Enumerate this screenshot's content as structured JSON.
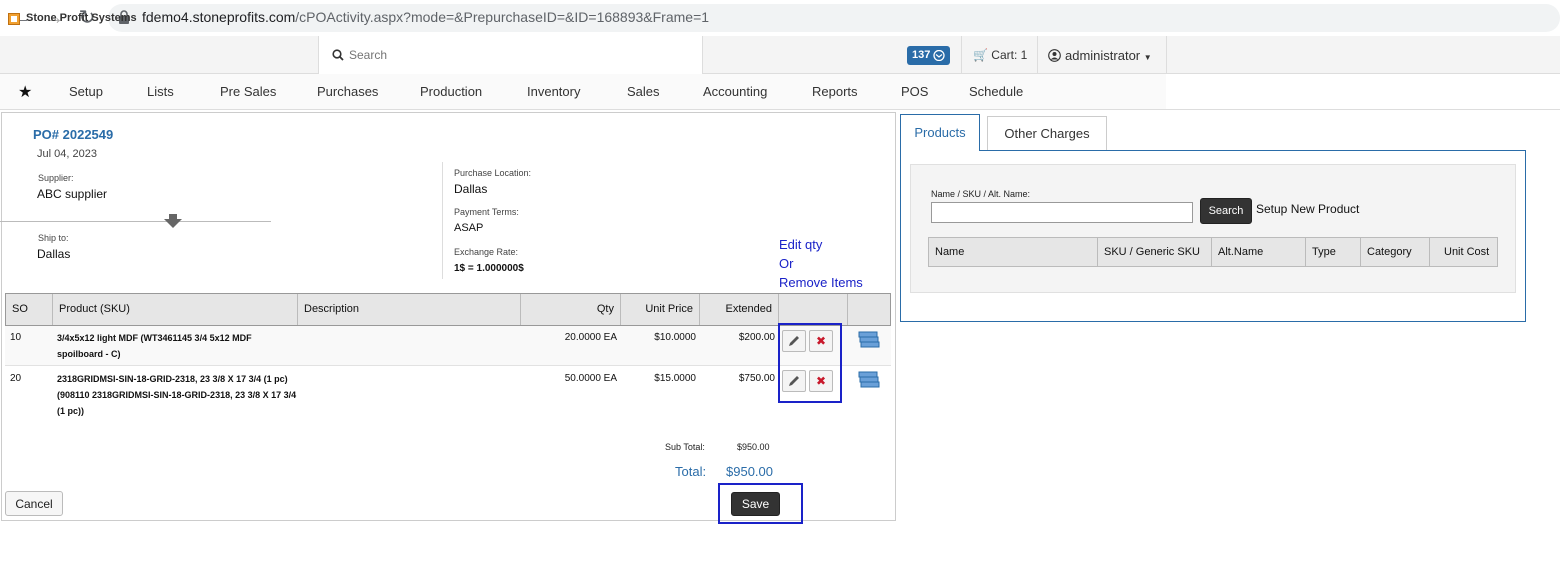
{
  "browser": {
    "url_host": "fdemo4.stoneprofits.com",
    "url_path": "/cPOActivity.aspx?mode=&PrepurchaseID=&ID=168893&Frame=1"
  },
  "header": {
    "brand": "Stone Profit Systems",
    "search_placeholder": "Search",
    "badge_count": "137",
    "cart_label": "Cart: 1",
    "user": "administrator"
  },
  "menu": [
    "Setup",
    "Lists",
    "Pre Sales",
    "Purchases",
    "Production",
    "Inventory",
    "Sales",
    "Accounting",
    "Reports",
    "POS",
    "Schedule"
  ],
  "po": {
    "title": "PO# 2022549",
    "date": "Jul 04, 2023",
    "supplier_label": "Supplier:",
    "supplier": "ABC supplier",
    "ship_label": "Ship to:",
    "ship_to": "Dallas",
    "location_label": "Purchase Location:",
    "location": "Dallas",
    "terms_label": "Payment Terms:",
    "terms": "ASAP",
    "exchange_label": "Exchange Rate:",
    "exchange": "1$  = 1.000000$"
  },
  "annotation": [
    "Edit qty",
    "Or",
    "Remove Items"
  ],
  "table": {
    "headers": [
      "SO",
      "Product (SKU)",
      "Description",
      "Qty",
      "Unit Price",
      "Extended"
    ],
    "rows": [
      {
        "so": "10",
        "product": "3/4x5x12 light MDF (WT3461145 3/4 5x12 MDF spoilboard - C)",
        "description": "",
        "qty": "20.0000 EA",
        "unit_price": "$10.0000",
        "extended": "$200.00"
      },
      {
        "so": "20",
        "product": "2318GRIDMSI-SIN-18-GRID-2318, 23 3/8 X 17 3/4 (1 pc) (908110 2318GRIDMSI-SIN-18-GRID-2318, 23 3/8 X 17 3/4 (1 pc))",
        "description": "",
        "qty": "50.0000 EA",
        "unit_price": "$15.0000",
        "extended": "$750.00"
      }
    ]
  },
  "totals": {
    "subtotal_label": "Sub Total:",
    "subtotal": "$950.00",
    "total_label": "Total:",
    "total": "$950.00"
  },
  "buttons": {
    "cancel": "Cancel",
    "save": "Save"
  },
  "right_panel": {
    "tabs": [
      "Products",
      "Other Charges"
    ],
    "field_label": "Name / SKU / Alt. Name:",
    "search_button": "Search",
    "setup_link": "Setup New Product",
    "headers": [
      "Name",
      "SKU / Generic SKU",
      "Alt.Name",
      "Type",
      "Category",
      "Unit Cost"
    ]
  },
  "colors": {
    "accent": "#2a6ca8",
    "annotation": "#1a22c8",
    "delete": "#c8182b"
  }
}
